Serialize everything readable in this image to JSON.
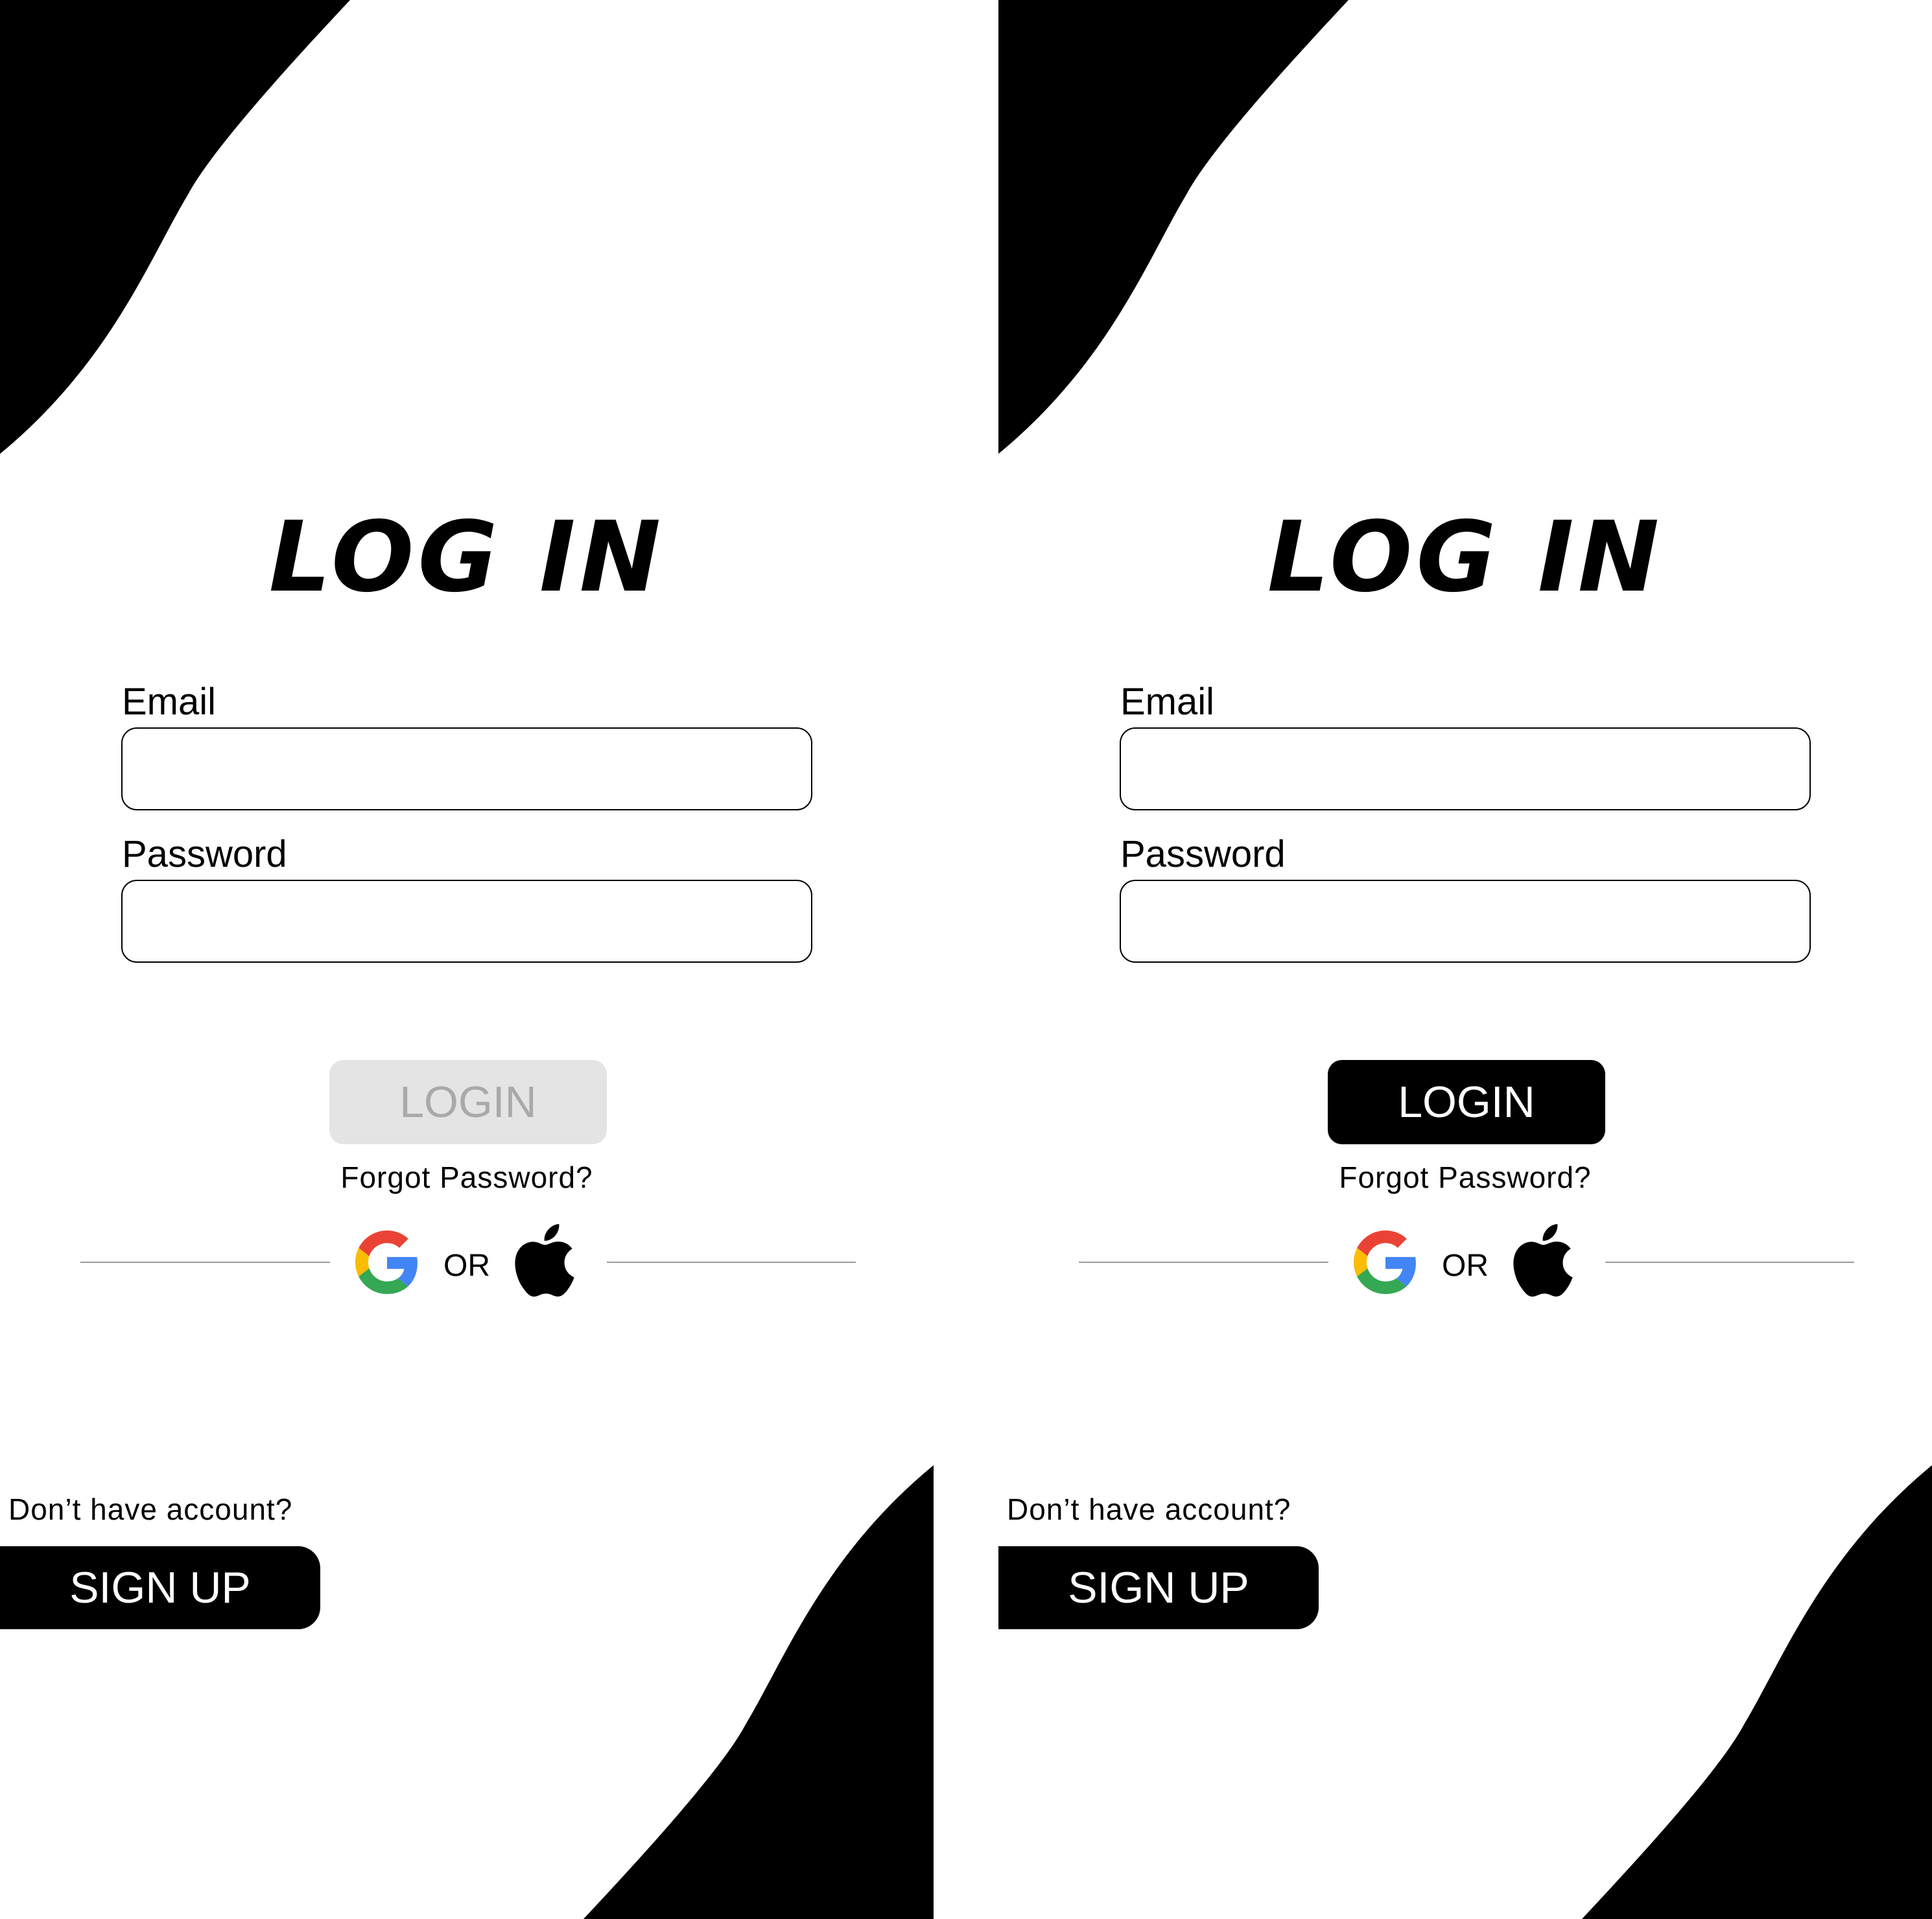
{
  "screens": [
    {
      "state": "disabled",
      "title": "LOG IN",
      "email_label": "Email",
      "email_value": "",
      "password_label": "Password",
      "password_value": "",
      "login_label": "LOGIN",
      "forgot_label": "Forgot Password?",
      "or_label": "OR",
      "no_account_label": "Don’t have account?",
      "signup_label": "SIGN UP"
    },
    {
      "state": "enabled",
      "title": "LOG IN",
      "email_label": "Email",
      "email_value": "",
      "password_label": "Password",
      "password_value": "",
      "login_label": "LOGIN",
      "forgot_label": "Forgot Password?",
      "or_label": "OR",
      "no_account_label": "Don’t have account?",
      "signup_label": "SIGN UP"
    }
  ],
  "icons": {
    "social_left": "google-icon",
    "social_right": "apple-icon"
  },
  "colors": {
    "background": "#ffffff",
    "primary": "#000000",
    "login_disabled_bg": "#e4e4e4",
    "login_disabled_text": "#a9a9a9",
    "divider": "#9a9a9a",
    "google_blue": "#4285F4",
    "google_red": "#EA4335",
    "google_yellow": "#FBBC05",
    "google_green": "#34A853"
  }
}
